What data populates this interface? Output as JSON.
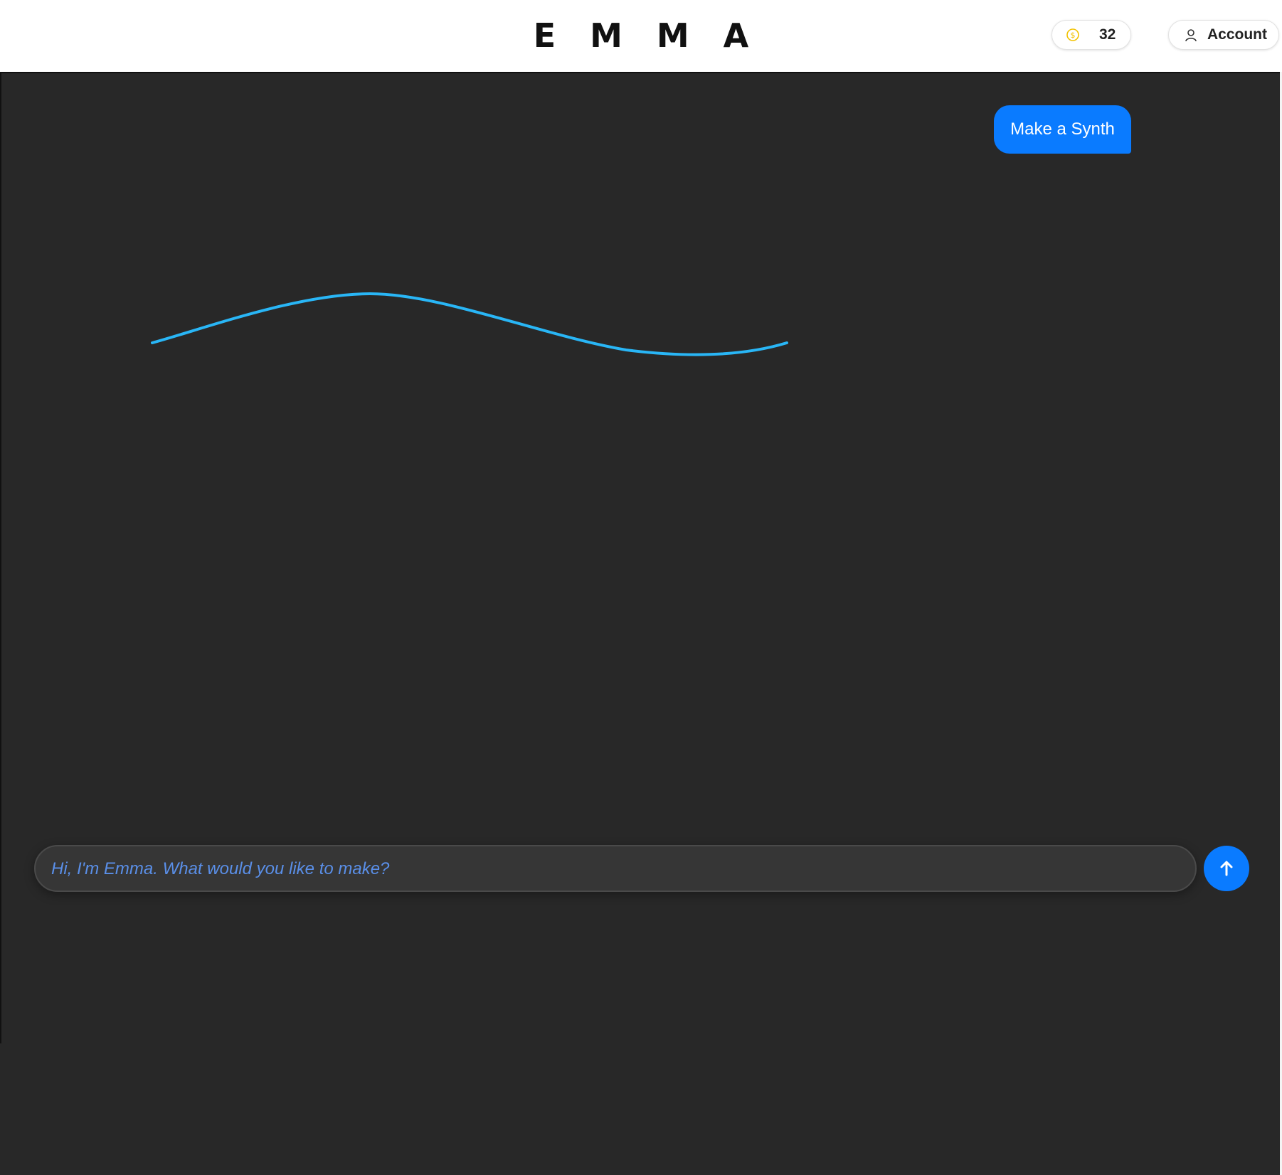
{
  "header": {
    "logo_text": "EMMA",
    "credits": {
      "value": "32",
      "icon": "coin-icon",
      "icon_color": "#f2c200"
    },
    "account": {
      "label": "Account",
      "icon": "user-icon"
    }
  },
  "conversation": {
    "messages": [
      {
        "role": "user",
        "text": "Make a Synth"
      }
    ],
    "waveform_icon": "sine-wave-icon",
    "waveform_color": "#29b6f6"
  },
  "composer": {
    "placeholder": "Hi, I'm Emma. What would you like to make?",
    "value": "",
    "send_icon": "arrow-up-icon"
  },
  "colors": {
    "accent": "#0a7bff",
    "background": "#282828",
    "header_background": "#ffffff",
    "placeholder_text": "#5a8fe8"
  }
}
